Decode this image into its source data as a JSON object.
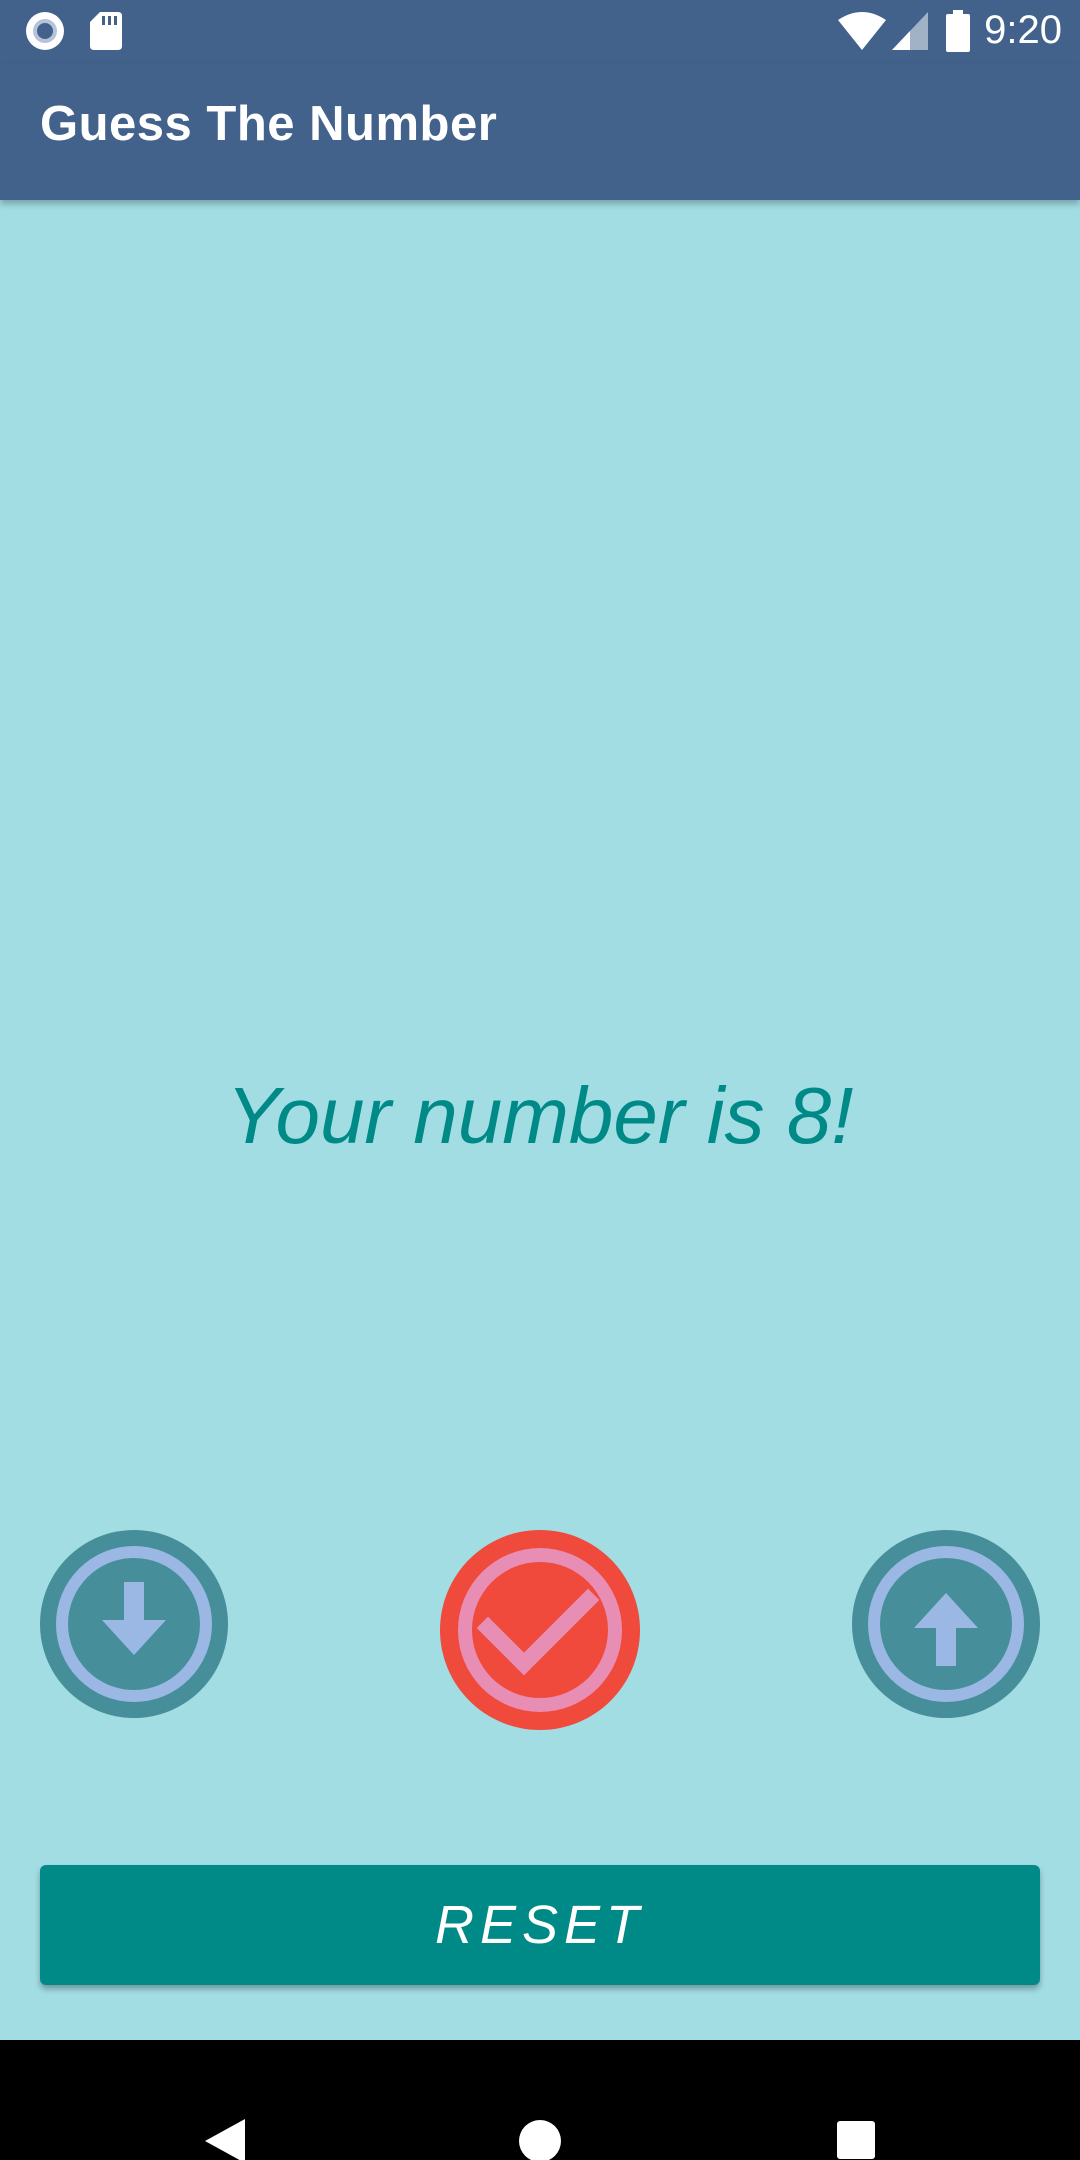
{
  "status_bar": {
    "time": "9:20",
    "icons": [
      "record-icon",
      "sd-card-icon",
      "wifi-icon",
      "signal-icon",
      "battery-icon"
    ]
  },
  "toolbar": {
    "title": "Guess The Number"
  },
  "main": {
    "message": "Your number is 8!"
  },
  "controls": {
    "lower_button_icon": "arrow-down-icon",
    "correct_button_icon": "checkmark-icon",
    "higher_button_icon": "arrow-up-icon"
  },
  "reset_button": {
    "label": "RESET"
  },
  "nav_bar": {
    "icons": [
      "back-icon",
      "home-icon",
      "recents-icon"
    ]
  },
  "colors": {
    "toolbar": "#42628c",
    "background": "#a1dde3",
    "accent_teal": "#008a87",
    "correct_red": "#ef4a3b",
    "correct_pink": "#e88db4",
    "arrow_ring_dark": "#468f9a",
    "arrow_ring_light": "#9ab8e3"
  }
}
